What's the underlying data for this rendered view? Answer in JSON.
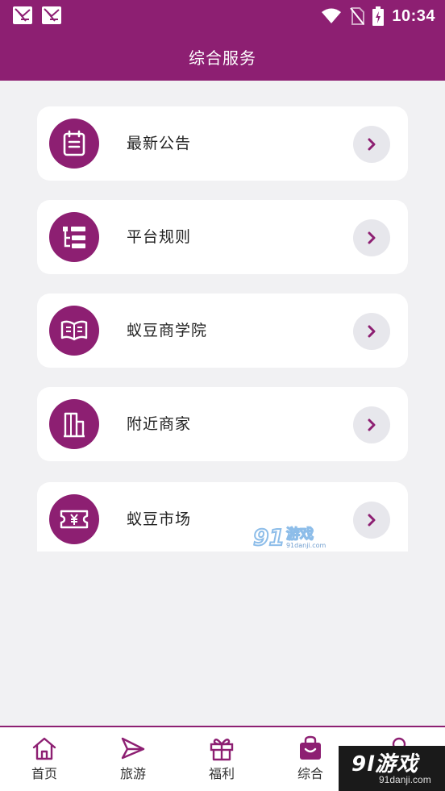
{
  "status_bar": {
    "time": "10:34",
    "icons": [
      "app-notification-icon",
      "app-notification-icon",
      "wifi-icon",
      "no-sim-icon",
      "battery-charging-icon"
    ]
  },
  "header": {
    "title": "综合服务"
  },
  "services": [
    {
      "label": "最新公告",
      "icon": "notice-icon"
    },
    {
      "label": "平台规则",
      "icon": "rules-list-icon"
    },
    {
      "label": "蚁豆商学院",
      "icon": "open-book-icon"
    },
    {
      "label": "附近商家",
      "icon": "building-icon"
    },
    {
      "label": "蚁豆市场",
      "icon": "yen-ticket-icon"
    }
  ],
  "tabbar": {
    "tabs": [
      {
        "label": "首页",
        "icon": "home-icon",
        "active": false
      },
      {
        "label": "旅游",
        "icon": "paper-plane-icon",
        "active": false
      },
      {
        "label": "福利",
        "icon": "gift-icon",
        "active": false
      },
      {
        "label": "综合",
        "icon": "shopping-bag-icon",
        "active": true
      },
      {
        "label": "",
        "icon": "profile-icon",
        "active": false
      }
    ]
  },
  "watermarks": {
    "mid_number": "91",
    "mid_text": "游戏",
    "mid_site": "91danji.com",
    "corner_text": "9l游戏",
    "corner_site": "91danji.com"
  },
  "colors": {
    "brand": "#8d1f72",
    "background": "#f1f1f3",
    "card": "#ffffff",
    "arrow_bg": "#e7e7ec"
  }
}
